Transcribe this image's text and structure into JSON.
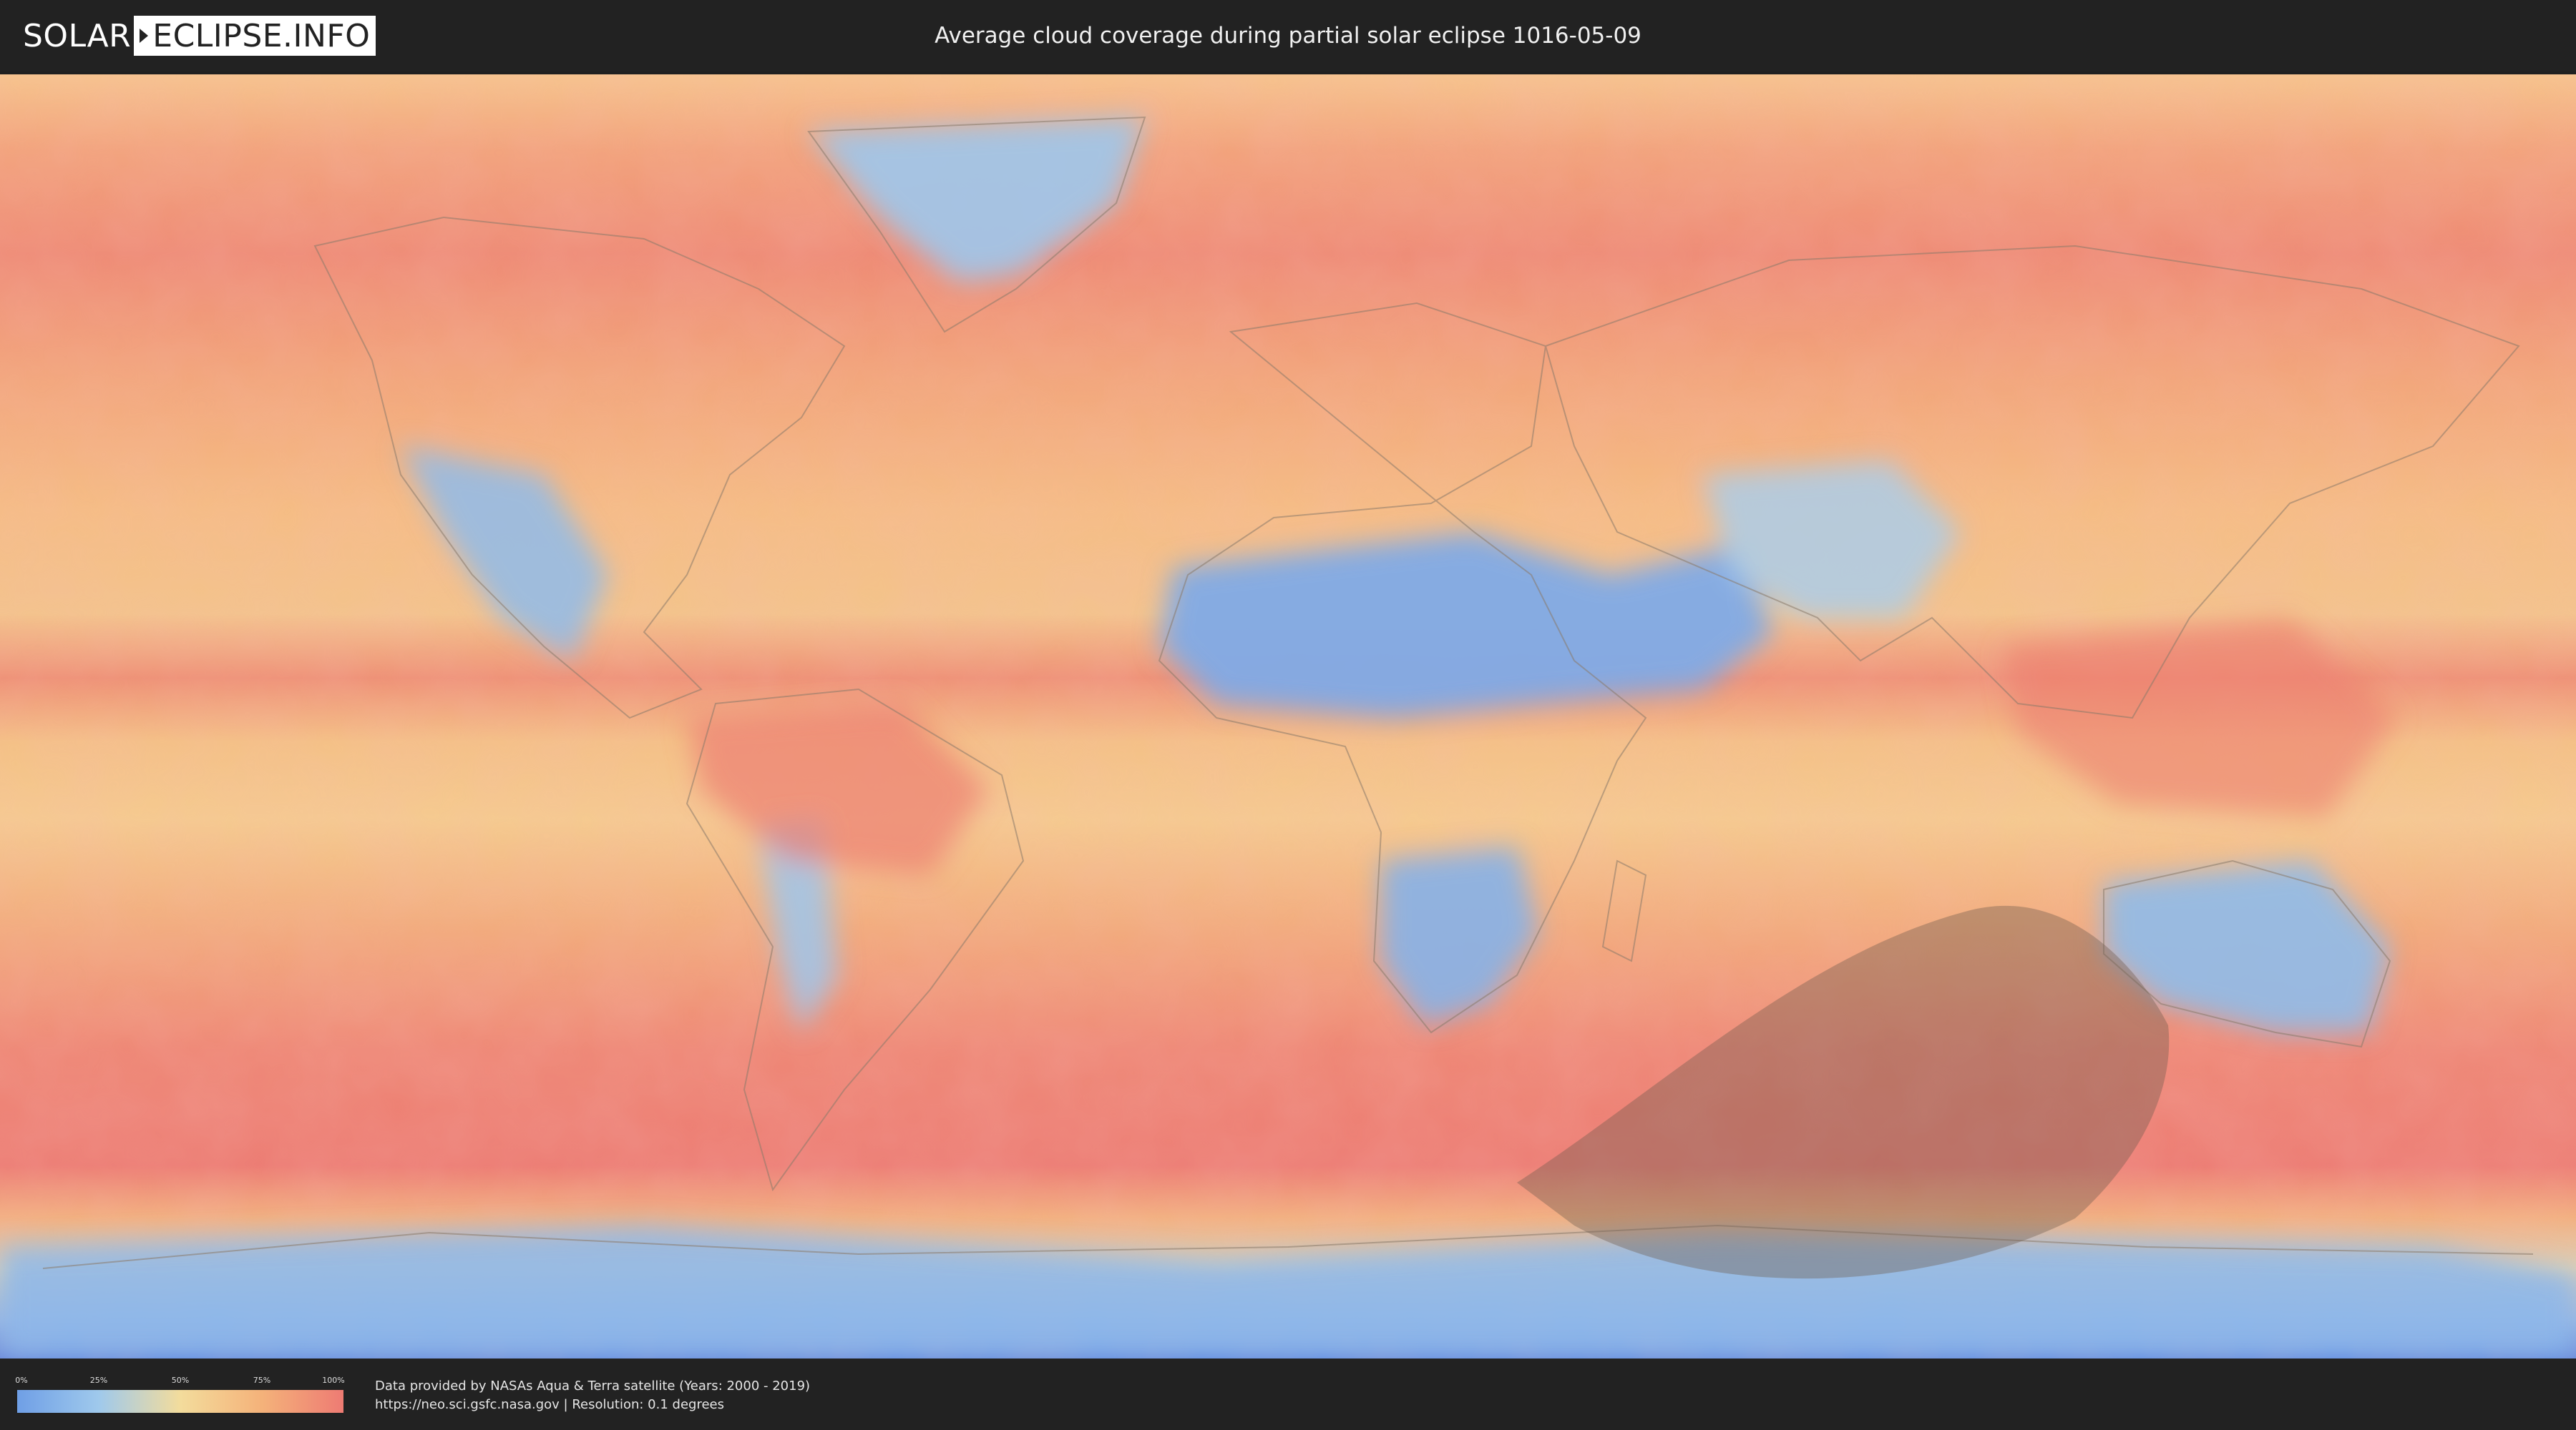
{
  "logo": {
    "left_text": "SOLAR",
    "right_text": "ECLIPSE.INFO",
    "mark_icon": "eclipse-arrow-icon"
  },
  "header": {
    "title": "Average cloud coverage during partial solar eclipse 1016-05-09"
  },
  "map": {
    "layer": "cloud-coverage",
    "projection": "equirectangular",
    "eclipse_shadow_color": "#6b5a4c",
    "ocean_cloud_color": "#f4b27a",
    "low_cloud_color": "#8fb8ea",
    "high_cloud_color": "#ee7b73"
  },
  "legend": {
    "ticks": [
      "0%",
      "25%",
      "50%",
      "75%",
      "100%"
    ],
    "gradient_colors": [
      "#6f9fe6",
      "#9fc9ec",
      "#f3dc9c",
      "#f4b27a",
      "#ee7b73"
    ]
  },
  "footer": {
    "credit_line_1": "Data provided by NASAs Aqua & Terra satellite (Years: 2000 - 2019)",
    "credit_line_2": "https://neo.sci.gsfc.nasa.gov | Resolution: 0.1 degrees"
  }
}
